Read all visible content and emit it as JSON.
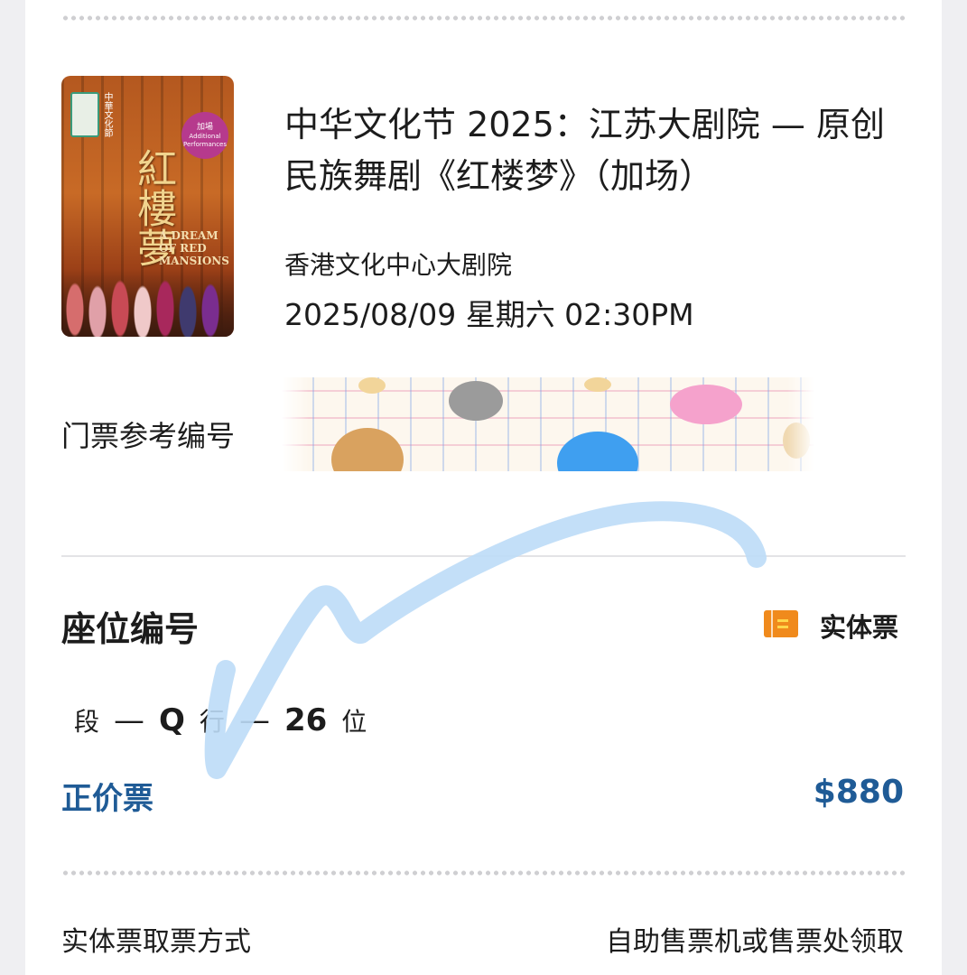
{
  "event": {
    "poster": {
      "org_text": "中華文化節",
      "badge_cn": "加場",
      "badge_en": "Additional Performances",
      "title_cn": "紅樓夢",
      "title_en": "A DREAM OF RED MANSIONS"
    },
    "title": "中华文化节 2025：江苏大剧院 — 原创民族舞剧《红楼梦》（加场）",
    "venue": "香港文化中心大剧院",
    "datetime": "2025/08/09 星期六 02:30PM"
  },
  "reference": {
    "label": "门票参考编号"
  },
  "seat": {
    "title": "座位编号",
    "ticket_type_icon": "ticket-icon",
    "ticket_type": "实体票",
    "section_suffix": "段",
    "dash1": "—",
    "row": "Q",
    "row_suffix": "行",
    "dash2": "—",
    "number": "26",
    "number_suffix": "位"
  },
  "price": {
    "label": "正价票",
    "amount": "$880"
  },
  "pickup": {
    "label": "实体票取票方式",
    "value": "自助售票机或售票处领取"
  },
  "colors": {
    "accent_blue": "#1f5b96",
    "ticket_icon_orange": "#f08a1c",
    "scribble_blue": "#bcdcf7"
  }
}
